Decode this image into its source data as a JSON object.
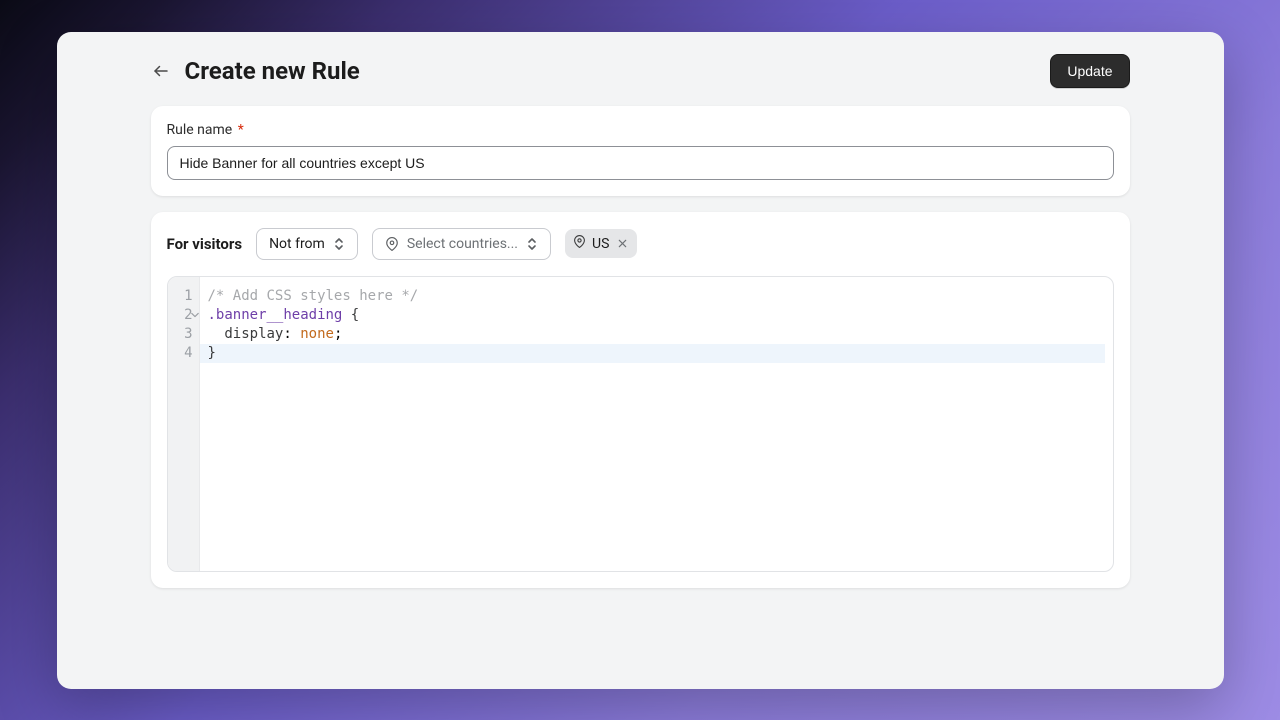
{
  "header": {
    "title": "Create new Rule",
    "update_label": "Update"
  },
  "rule_name": {
    "label": "Rule name",
    "required_mark": "*",
    "value": "Hide Banner for all countries except US"
  },
  "visitors": {
    "label": "For visitors",
    "condition_selected": "Not from",
    "country_placeholder": "Select countries...",
    "chips": [
      {
        "code": "US"
      }
    ]
  },
  "editor": {
    "line_numbers": [
      "1",
      "2",
      "3",
      "4"
    ],
    "highlighted_line_index": 3,
    "code": {
      "line1_comment": "/* Add CSS styles here */",
      "line2_selector": ".banner__heading",
      "line2_brace": " {",
      "line3_indent": "  ",
      "line3_prop": "display",
      "line3_colon": ": ",
      "line3_value": "none",
      "line3_semi": ";",
      "line4_brace": "}"
    }
  }
}
